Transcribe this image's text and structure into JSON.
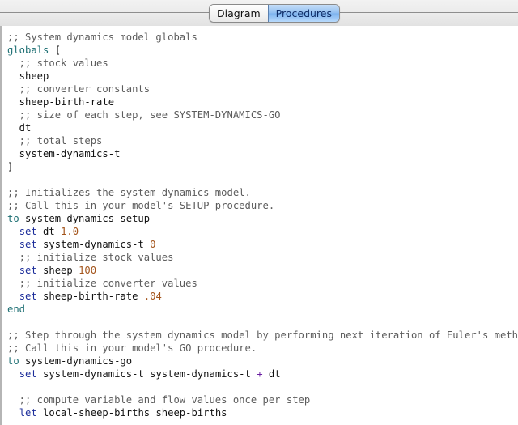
{
  "tabs": [
    {
      "label": "Diagram",
      "active": false
    },
    {
      "label": "Procedures",
      "active": true
    }
  ],
  "colors": {
    "comment": "#5c5c5c",
    "definition_keyword": "#1d6f73",
    "command_keyword": "#1c2d9a",
    "number": "#a3541b",
    "operator": "#6a1fa2",
    "active_tab": "#7cb2ee"
  },
  "code": [
    [
      {
        "t": "cm",
        "v": ";; System dynamics model globals"
      }
    ],
    [
      {
        "t": "kw-def",
        "v": "globals"
      },
      {
        "t": "id",
        "v": " ["
      }
    ],
    [
      {
        "t": "cm",
        "v": "  ;; stock values"
      }
    ],
    [
      {
        "t": "id",
        "v": "  sheep"
      }
    ],
    [
      {
        "t": "cm",
        "v": "  ;; converter constants"
      }
    ],
    [
      {
        "t": "id",
        "v": "  sheep-birth-rate"
      }
    ],
    [
      {
        "t": "cm",
        "v": "  ;; size of each step, see SYSTEM-DYNAMICS-GO"
      }
    ],
    [
      {
        "t": "id",
        "v": "  dt"
      }
    ],
    [
      {
        "t": "cm",
        "v": "  ;; total steps"
      }
    ],
    [
      {
        "t": "id",
        "v": "  system-dynamics-t"
      }
    ],
    [
      {
        "t": "id",
        "v": "]"
      }
    ],
    [],
    [
      {
        "t": "cm",
        "v": ";; Initializes the system dynamics model."
      }
    ],
    [
      {
        "t": "cm",
        "v": ";; Call this in your model's SETUP procedure."
      }
    ],
    [
      {
        "t": "kw-def",
        "v": "to"
      },
      {
        "t": "id",
        "v": " system-dynamics-setup"
      }
    ],
    [
      {
        "t": "id",
        "v": "  "
      },
      {
        "t": "kw-cmd",
        "v": "set"
      },
      {
        "t": "id",
        "v": " dt "
      },
      {
        "t": "num",
        "v": "1.0"
      }
    ],
    [
      {
        "t": "id",
        "v": "  "
      },
      {
        "t": "kw-cmd",
        "v": "set"
      },
      {
        "t": "id",
        "v": " system-dynamics-t "
      },
      {
        "t": "num",
        "v": "0"
      }
    ],
    [
      {
        "t": "cm",
        "v": "  ;; initialize stock values"
      }
    ],
    [
      {
        "t": "id",
        "v": "  "
      },
      {
        "t": "kw-cmd",
        "v": "set"
      },
      {
        "t": "id",
        "v": " sheep "
      },
      {
        "t": "num",
        "v": "100"
      }
    ],
    [
      {
        "t": "cm",
        "v": "  ;; initialize converter values"
      }
    ],
    [
      {
        "t": "id",
        "v": "  "
      },
      {
        "t": "kw-cmd",
        "v": "set"
      },
      {
        "t": "id",
        "v": " sheep-birth-rate "
      },
      {
        "t": "num",
        "v": ".04"
      }
    ],
    [
      {
        "t": "kw-def",
        "v": "end"
      }
    ],
    [],
    [
      {
        "t": "cm",
        "v": ";; Step through the system dynamics model by performing next iteration of Euler's method."
      }
    ],
    [
      {
        "t": "cm",
        "v": ";; Call this in your model's GO procedure."
      }
    ],
    [
      {
        "t": "kw-def",
        "v": "to"
      },
      {
        "t": "id",
        "v": " system-dynamics-go"
      }
    ],
    [
      {
        "t": "id",
        "v": "  "
      },
      {
        "t": "kw-cmd",
        "v": "set"
      },
      {
        "t": "id",
        "v": " system-dynamics-t system-dynamics-t "
      },
      {
        "t": "op",
        "v": "+"
      },
      {
        "t": "id",
        "v": " dt"
      }
    ],
    [],
    [
      {
        "t": "cm",
        "v": "  ;; compute variable and flow values once per step"
      }
    ],
    [
      {
        "t": "id",
        "v": "  "
      },
      {
        "t": "kw-cmd",
        "v": "let"
      },
      {
        "t": "id",
        "v": " local-sheep-births sheep-births"
      }
    ]
  ]
}
